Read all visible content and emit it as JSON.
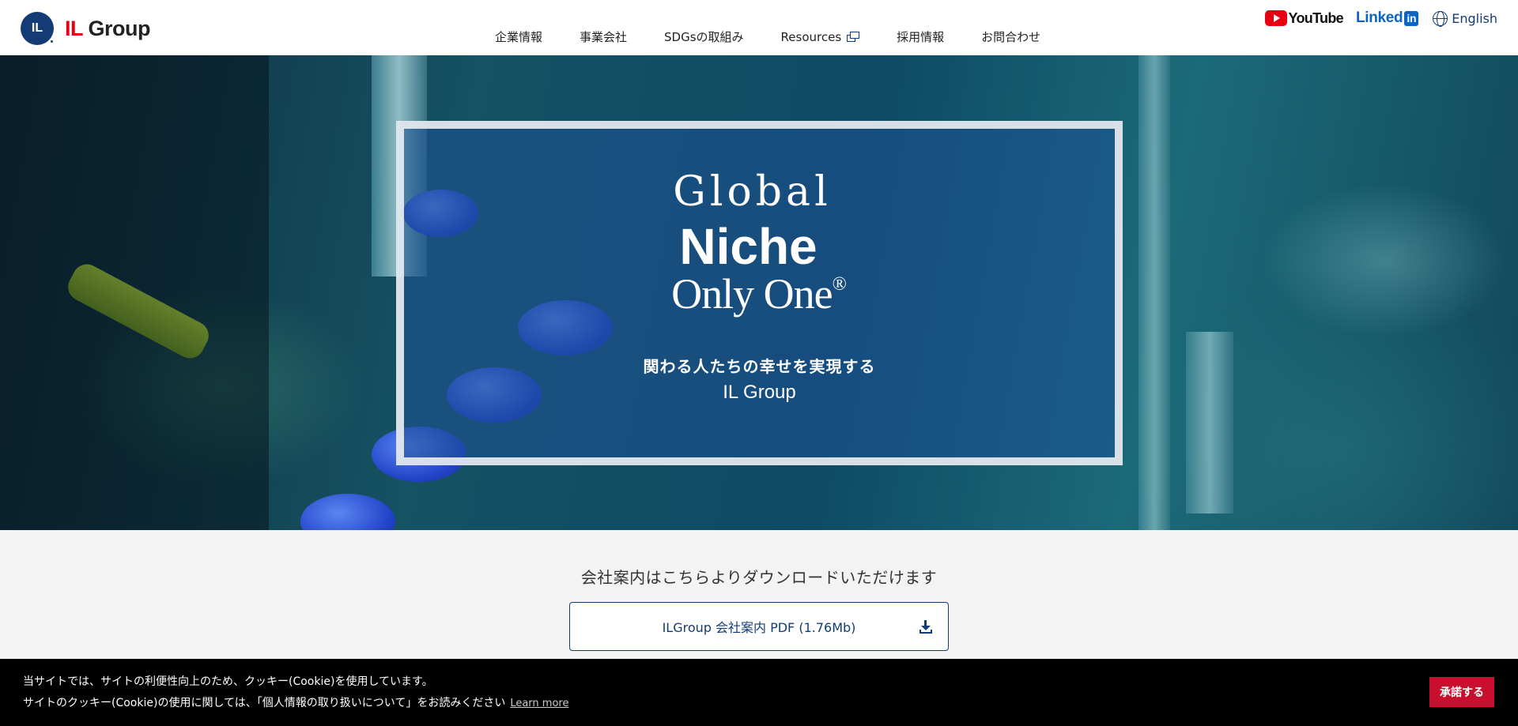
{
  "header": {
    "logo_mark": "IL",
    "logo_il": "IL",
    "logo_group": " Group",
    "nav": [
      {
        "label": "企業情報"
      },
      {
        "label": "事業会社"
      },
      {
        "label": "SDGsの取組み"
      },
      {
        "label": "Resources",
        "icon": "external-window-icon"
      },
      {
        "label": "採用情報"
      },
      {
        "label": "お問合わせ"
      }
    ],
    "youtube_label": "YouTube",
    "linkedin_label": "Linked",
    "linkedin_box": "in",
    "language_label": "English"
  },
  "hero": {
    "line1": "Global",
    "line2": "Niche",
    "line3": "Only One",
    "registered": "®",
    "subtitle": "関わる人たちの幸せを実現する",
    "company": "IL Group"
  },
  "download": {
    "title": "会社案内はこちらよりダウンロードいただけます",
    "button_label": "ILGroup 会社案内 PDF (1.76Mb)",
    "icon": "download-icon"
  },
  "cookie": {
    "line1": "当サイトでは、サイトの利便性向上のため、クッキー(Cookie)を使用しています。",
    "line2": "サイトのクッキー(Cookie)の使用に関しては、「個人情報の取り扱いについて」をお読みください",
    "learn_more": "Learn more",
    "accept": "承諾する"
  },
  "colors": {
    "brand_navy": "#143c74",
    "brand_red": "#e60012",
    "cookie_button": "#c8102e"
  }
}
